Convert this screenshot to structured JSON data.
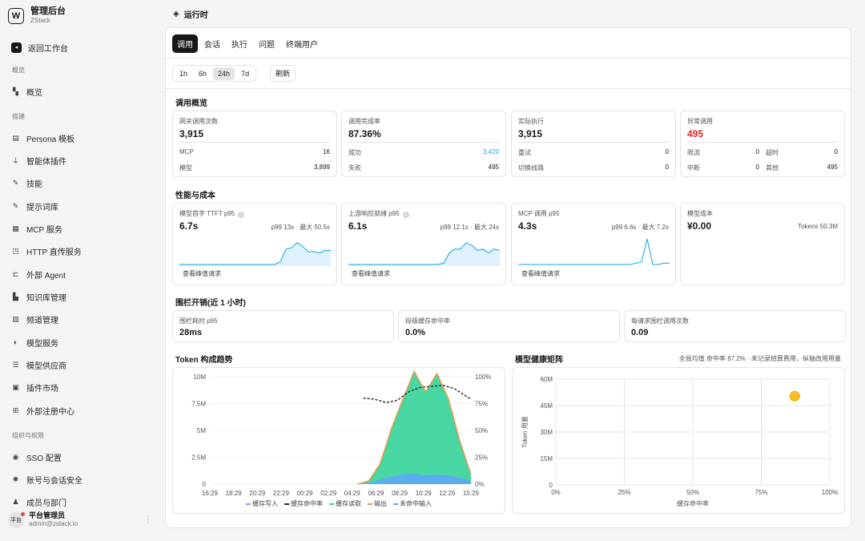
{
  "brand": {
    "title": "管理后台",
    "subtitle": "ZStack",
    "logo_glyph": "W"
  },
  "nav": {
    "back": "返回工作台",
    "sec_overview": "概览",
    "overview": "概览",
    "sec_build": "搭建",
    "items": [
      "Persona 模板",
      "智能体插件",
      "技能",
      "提示词库",
      "MCP 服务",
      "HTTP 直传服务",
      "外部 Agent",
      "知识库管理",
      "频道管理",
      "模型服务",
      "模型供应商",
      "插件市场",
      "外部注册中心"
    ],
    "sec_org": "组织与权限",
    "org_items": [
      "SSO 配置",
      "账号与会话安全",
      "成员与部门"
    ]
  },
  "user": {
    "avatar": "平台",
    "name": "平台管理员",
    "email": "admin@zstack.io"
  },
  "page": {
    "title": "运行时"
  },
  "tabs": [
    "调用",
    "会话",
    "执行",
    "问题",
    "终端用户"
  ],
  "ranges": [
    "1h",
    "6h",
    "24h",
    "7d"
  ],
  "refresh": "刷新",
  "overview": {
    "title": "调用概览",
    "cards": [
      {
        "label": "网关调用次数",
        "value": "3,915",
        "rows": [
          [
            "MCP",
            "16"
          ],
          [
            "模型",
            "3,899"
          ]
        ]
      },
      {
        "label": "调用完成率",
        "value": "87.36%",
        "rows": [
          [
            "成功",
            "3,420"
          ],
          [
            "失败",
            "495"
          ]
        ]
      },
      {
        "label": "实际执行",
        "value": "3,915",
        "rows": [
          [
            "重试",
            "0"
          ],
          [
            "切换线路",
            "0"
          ]
        ]
      },
      {
        "label": "异常调用",
        "value": "495",
        "rows": [
          [
            "限流",
            "0"
          ],
          [
            "超时",
            "0"
          ],
          [
            "中断",
            "0"
          ],
          [
            "其他",
            "495"
          ]
        ]
      }
    ]
  },
  "perf": {
    "title": "性能与成本",
    "cards": [
      {
        "label": "模型首字 TTFT p95",
        "value": "6.7s",
        "right": "p99 13s · 最大 50.5s",
        "link": "查看峰值请求"
      },
      {
        "label": "上游响应就绪 p95",
        "value": "6.1s",
        "right": "p99 12.1s · 最大 24s",
        "link": "查看峰值请求"
      },
      {
        "label": "MCP 调用 p95",
        "value": "4.3s",
        "right": "p99 6.6s · 最大 7.2s",
        "link": "查看峰值请求"
      },
      {
        "label": "模型成本",
        "value": "¥0.00",
        "right": "Tokens 50.3M"
      }
    ]
  },
  "guard": {
    "title": "围栏开销(近 1 小时)",
    "cards": [
      {
        "label": "围栏耗时 p95",
        "value": "28ms"
      },
      {
        "label": "段级缓存命中率",
        "value": "0.0%"
      },
      {
        "label": "每请求围栏调用次数",
        "value": "0.09"
      }
    ]
  },
  "token_trend": {
    "title": "Token 构成趋势"
  },
  "health": {
    "title": "模型健康矩阵",
    "note": "全局均值 命中率 87.2% · 未记录结算费用，纵轴改用用量"
  },
  "chart_data": [
    {
      "type": "area",
      "title": "Token 构成趋势",
      "x": [
        "16:29",
        "18:29",
        "20:29",
        "22:29",
        "00:29",
        "02:29",
        "04:29",
        "06:29",
        "08:29",
        "10:29",
        "12:29",
        "15:29"
      ],
      "y_left_ticks": [
        "0",
        "2.5M",
        "5M",
        "7.5M",
        "10M"
      ],
      "y_right_ticks": [
        "0%",
        "25%",
        "50%",
        "75%",
        "100%"
      ],
      "ylim": [
        0,
        10000000
      ],
      "legend": [
        "缓存写入",
        "缓存命中率",
        "缓存读取",
        "输出",
        "未命中输入"
      ],
      "colors": {
        "cache_write": "#a78bfa",
        "hit_rate": "#27272a",
        "cache_read": "#34d399",
        "output": "#fb923c",
        "miss_input": "#60a5fa"
      },
      "series": [
        {
          "name": "缓存读取",
          "x": [
            "05:29",
            "06:29",
            "07:29",
            "08:29",
            "09:29",
            "10:29",
            "11:29",
            "12:29",
            "13:29",
            "14:29",
            "15:29"
          ],
          "values": [
            0,
            200000,
            1500000,
            4500000,
            7000000,
            9500000,
            7800000,
            9400000,
            7200000,
            3500000,
            600000
          ]
        },
        {
          "name": "未命中输入",
          "x": [
            "05:29",
            "06:29",
            "07:29",
            "08:29",
            "09:29",
            "10:29",
            "11:29",
            "12:29",
            "13:29",
            "14:29",
            "15:29"
          ],
          "values": [
            0,
            100000,
            400000,
            700000,
            900000,
            1000000,
            800000,
            900000,
            800000,
            600000,
            300000
          ]
        },
        {
          "name": "缓存命中率",
          "x": [
            "06:00",
            "07:00",
            "08:00",
            "09:00",
            "10:00",
            "11:00",
            "12:00",
            "13:00",
            "14:00",
            "15:29"
          ],
          "values": [
            80,
            79,
            76,
            78,
            86,
            90,
            91,
            92,
            89,
            79
          ]
        }
      ]
    },
    {
      "type": "scatter",
      "title": "模型健康矩阵",
      "xlabel": "缓存命中率",
      "ylabel": "Token 用量",
      "x_ticks": [
        "0%",
        "25%",
        "50%",
        "75%",
        "100%"
      ],
      "y_ticks": [
        "0",
        "15M",
        "30M",
        "45M",
        "60M"
      ],
      "xlim": [
        0,
        100
      ],
      "ylim": [
        0,
        60000000
      ],
      "points": [
        {
          "x": 87.2,
          "y": 50300000
        }
      ],
      "point_color": "#fbbf24"
    }
  ],
  "spark": [
    [
      0,
      0,
      0,
      0,
      0,
      0,
      0,
      0,
      0,
      0,
      0,
      0,
      0,
      0,
      0,
      0,
      0,
      0,
      0.1,
      0.6,
      0.65,
      0.85,
      0.7,
      0.5,
      0.5,
      0.45,
      0.55,
      0.55
    ],
    [
      0,
      0,
      0,
      0,
      0,
      0,
      0,
      0,
      0,
      0,
      0,
      0,
      0,
      0,
      0,
      0,
      0,
      0.05,
      0.45,
      0.6,
      0.6,
      0.85,
      0.75,
      0.55,
      0.6,
      0.45,
      0.6,
      0.55
    ],
    [
      0,
      0,
      0,
      0,
      0,
      0,
      0,
      0,
      0,
      0,
      0,
      0,
      0,
      0,
      0,
      0,
      0,
      0,
      0,
      0,
      0,
      0.05,
      0.1,
      1.0,
      0,
      0,
      0.05,
      0.05
    ]
  ]
}
